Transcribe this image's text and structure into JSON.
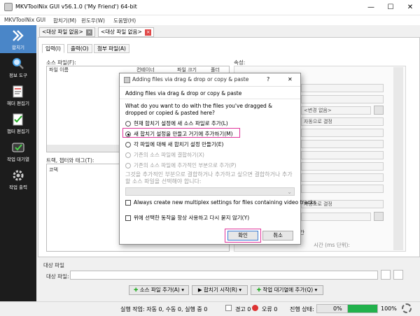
{
  "window": {
    "title": "MKVToolNix GUI v56.1.0 ('My Friend') 64-bit",
    "min": "—",
    "max": "☐",
    "close": "✕"
  },
  "menu": [
    "MKVToolNix GUI",
    "합치기(M)",
    "윈도우(W)",
    "도움말(H)"
  ],
  "sidebar": {
    "items": [
      {
        "label": "합치기"
      },
      {
        "label": "정보 도구"
      },
      {
        "label": "헤더 편집기"
      },
      {
        "label": "챕터 편집기"
      },
      {
        "label": "작업 대기열"
      },
      {
        "label": "작업 출력"
      }
    ]
  },
  "doc_tabs": [
    "<대상 파일 없음>",
    "<대상 파일 없음>"
  ],
  "sub_tabs": [
    "입력(I)",
    "출력(O)",
    "첨부 파일(A)"
  ],
  "source": {
    "label": "소스 파일(F):",
    "columns": [
      "파일 이름",
      "컨테이너",
      "파일 크기",
      "폴더"
    ]
  },
  "tracks": {
    "label": "트랙, 챕터와 태그(T):",
    "first_col": "코덱"
  },
  "props": {
    "label": "속성:",
    "change_none": "<변경 없음>",
    "auto1": "자동으로 결정",
    "auto2": "자동으로 결정",
    "partial_label": "간",
    "partial_text": "시간 (ms 단위):"
  },
  "dialog": {
    "title": "Adding files via drag & drop or copy & paste",
    "help": "?",
    "close": "✕",
    "heading": "Adding files via drag & drop or copy & paste",
    "question": "What do you want to do with the files you've dragged & dropped or copied & pasted here?",
    "options": [
      "현재 합치기 설정에 새 소스 파일로 추가(L)",
      "새 합치기 설정을 만들고 거기에 추가하기(M)",
      "각 파일에 대해 새 합치기 설정 만들기(E)",
      "기존의 소스 파일에 결합하기(X)",
      "기존의 소스 파일에 추가적인 부분으로 추가(P)"
    ],
    "hint": "그것을 추가적인 부분으로 결합하거나 추가하고 싶으면 결합하거나 추가할 소스 파일을 선택해야 합니다:",
    "check1": "Always create new multiplex settings for files containing video tracks",
    "check2": "위에 선택한 동작을 항상 사용하고 다시 묻지 않기(Y)",
    "ok": "확인",
    "cancel": "취소"
  },
  "destination": {
    "group": "대상 파일",
    "label": "대상 파일:"
  },
  "actions": {
    "add_source": "소스 파일 추가(A)",
    "start_mux": "합치기 시작(R)",
    "add_queue": "작업 대기열에 추가(Q)"
  },
  "status": {
    "jobs": "실행 작업: 자동 0, 수동 0, 실행 중 0",
    "warnings": "경고 0",
    "errors": "오류 0",
    "progress_label": "진행 상태:",
    "pct1": "0%",
    "pct2": "100%",
    "progress_current": 0,
    "progress_total": 100
  },
  "colors": {
    "accent": "#4a86c8",
    "highlight": "#e0349a",
    "green": "#22b14c"
  }
}
